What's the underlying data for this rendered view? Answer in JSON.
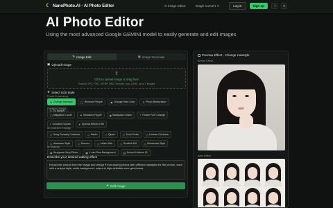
{
  "header": {
    "brand": "NanoPhoto.AI - AI Photo Editor",
    "nav": [
      "AI Image Editor",
      "Image Convert"
    ],
    "login": "Log in",
    "signup": "Sign up"
  },
  "hero": {
    "title": "AI Photo Editor",
    "subtitle": "Using the most advanced Google GEMINI model to easily generate and edit images"
  },
  "tabs": {
    "edit": "Image Edit",
    "generate": "Image Generate"
  },
  "upload": {
    "label": "Upload Image",
    "title": "Click to upload image or drag here",
    "hint": "Support JPG, PNG, WEBP, HEIC formats, max 10MB, up to 3 images"
  },
  "style": {
    "label": "Select Edit Style",
    "photo_processing": {
      "label": "Photo Processing",
      "items": [
        "Change Hairstyle",
        "Remove People",
        "Change Hair Color",
        "Photo Restoration",
        "To Sketch"
      ]
    },
    "creative_design": {
      "label": "Creative Design",
      "items": [
        "Magazine Cover",
        "Miniature Figure",
        "Backpack Charm",
        "Poster Font Change",
        "Creative Doodle",
        "Special Effects Hdb"
      ]
    },
    "ai_costume": {
      "label": "AI Costume Change",
      "items": [
        "Song Dynasty Costume",
        "Hanfu",
        "Qipao",
        "Tunic Robe",
        "Korean Costume",
        "Ukrainian Style",
        "Kimono",
        "Indian Sari",
        "Scottish Kilt",
        "Bohemian Style"
      ]
    },
    "ai_makeup": {
      "label": "AI Makeup",
      "items": [
        "Sexypose Stop Photo",
        "1 min Blue Background",
        "School Uniform ID"
      ]
    }
  },
  "description": {
    "label": "Describe your desired editing effect",
    "text": "Extract the portrait from the image and design 9 front-facing photos with different hairstyles for the person, each with a unique style, white background, output in high-definition nine-grid format."
  },
  "edit_button": "Edit Image",
  "preview": {
    "title": "Preview Effect - Change Hairstyle",
    "before": "Before Effect",
    "after": "After Effect"
  },
  "colors": {
    "accent": "#3ec46d",
    "background": "#0f1210",
    "panel": "#141816"
  }
}
